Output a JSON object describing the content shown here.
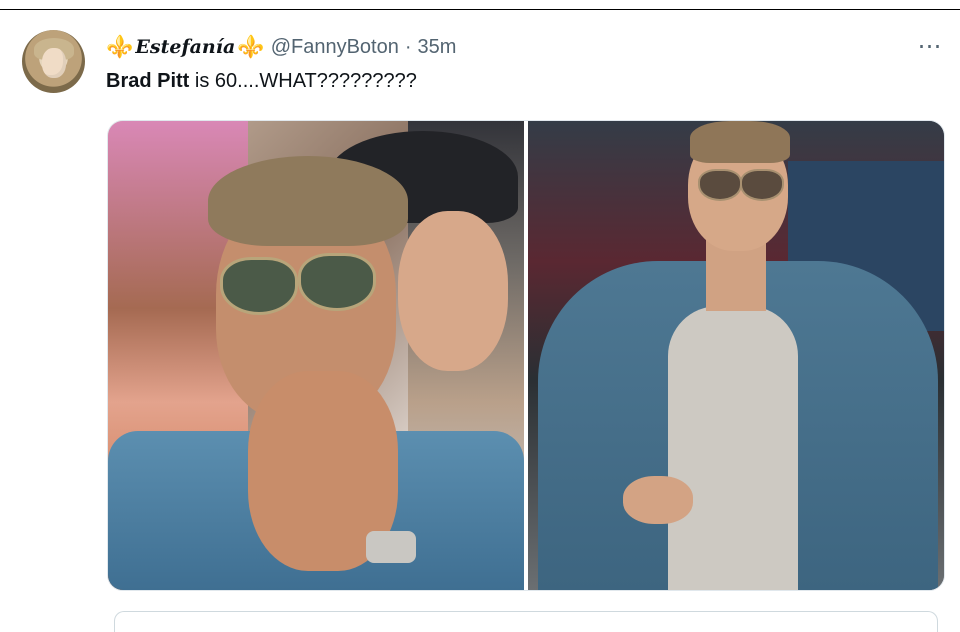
{
  "tweet": {
    "display_name": "Estefanía",
    "name_emoji_left": "⚜️",
    "name_emoji_right": "⚜️",
    "handle": "@FannyBoton",
    "separator": "·",
    "time": "35m",
    "more_icon": "⋯",
    "text_bold": "Brad Pitt",
    "text_rest": " is 60....WHAT?????????"
  },
  "media": {
    "images": [
      {
        "name": "photo-left"
      },
      {
        "name": "photo-right"
      }
    ]
  },
  "colors": {
    "text_primary": "#0f1419",
    "text_secondary": "#536471",
    "emoji_purple": "#7d4bb0",
    "border": "#cfd9de"
  }
}
